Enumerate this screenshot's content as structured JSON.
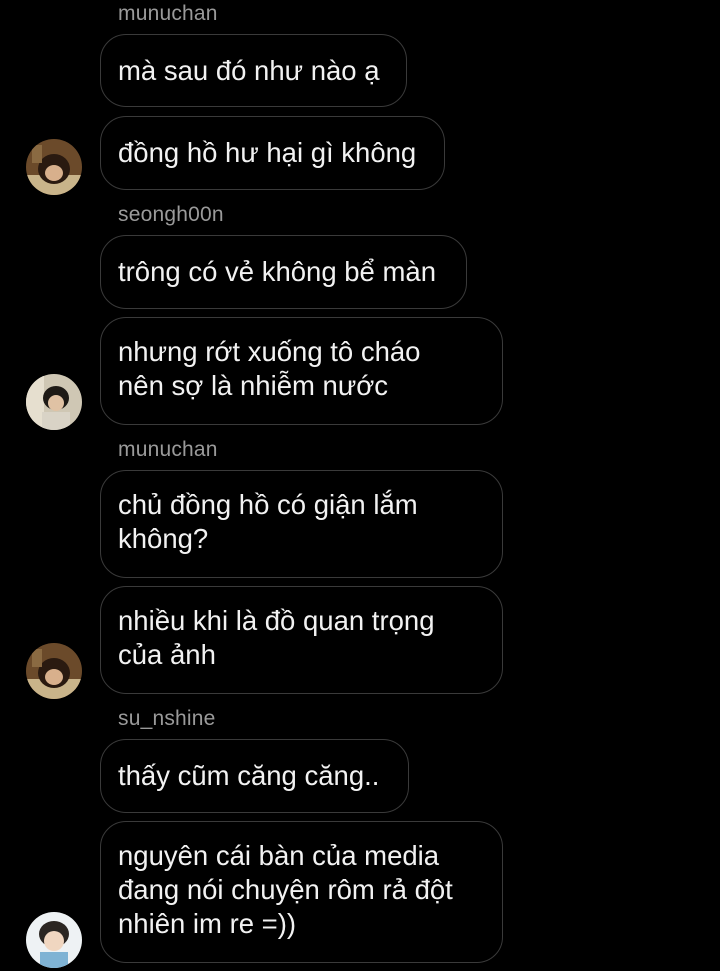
{
  "groups": [
    {
      "username": "munuchan",
      "avatar": "avatar-munuchan",
      "messages": [
        "mà sau đó như nào ạ",
        "đồng hồ hư hại gì không"
      ]
    },
    {
      "username": "seongh00n",
      "avatar": "avatar-seongh00n",
      "messages": [
        "trông có vẻ không bể màn",
        "nhưng rớt xuống tô cháo\nnên sợ là nhiễm nước"
      ]
    },
    {
      "username": "munuchan",
      "avatar": "avatar-munuchan",
      "messages": [
        "chủ đồng hồ có giận lắm\nkhông?",
        "nhiều khi là đồ quan trọng\ncủa ảnh"
      ]
    },
    {
      "username": "su_nshine",
      "avatar": "avatar-su-nshine",
      "messages": [
        "thấy cũm căng căng..",
        "nguyên cái bàn của media\nđang nói chuyện rôm rả đột\nnhiên im re =))"
      ]
    }
  ]
}
